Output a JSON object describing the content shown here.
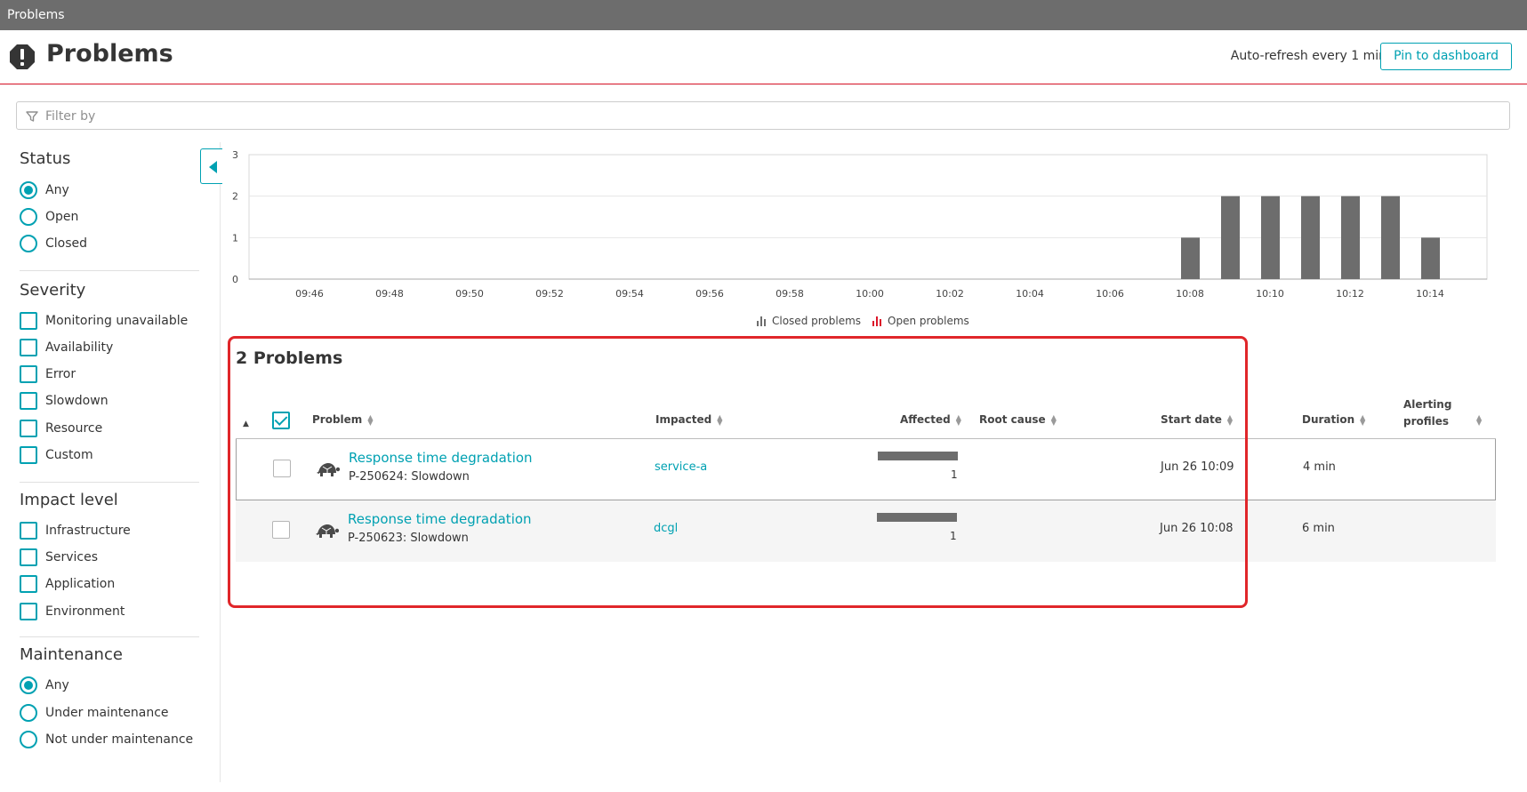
{
  "window": {
    "title": "Problems"
  },
  "header": {
    "title": "Problems",
    "auto_refresh": "Auto-refresh every 1 min",
    "pin_label": "Pin to dashboard"
  },
  "filter": {
    "placeholder": "Filter by"
  },
  "sidebar": {
    "status": {
      "title": "Status",
      "options": [
        "Any",
        "Open",
        "Closed"
      ],
      "selected": "Any"
    },
    "severity": {
      "title": "Severity",
      "options": [
        "Monitoring unavailable",
        "Availability",
        "Error",
        "Slowdown",
        "Resource",
        "Custom"
      ]
    },
    "impact": {
      "title": "Impact level",
      "options": [
        "Infrastructure",
        "Services",
        "Application",
        "Environment"
      ]
    },
    "maintenance": {
      "title": "Maintenance",
      "options": [
        "Any",
        "Under maintenance",
        "Not under maintenance"
      ],
      "selected": "Any"
    }
  },
  "chart_data": {
    "type": "bar",
    "categories": [
      "09:46",
      "09:47",
      "09:48",
      "09:49",
      "09:50",
      "09:51",
      "09:52",
      "09:53",
      "09:54",
      "09:55",
      "09:56",
      "09:57",
      "09:58",
      "09:59",
      "10:00",
      "10:01",
      "10:02",
      "10:03",
      "10:04",
      "10:05",
      "10:06",
      "10:07",
      "10:08",
      "10:09",
      "10:10",
      "10:11",
      "10:12",
      "10:13",
      "10:14"
    ],
    "x_tick_labels": [
      "09:46",
      "09:48",
      "09:50",
      "09:52",
      "09:54",
      "09:56",
      "09:58",
      "10:00",
      "10:02",
      "10:04",
      "10:06",
      "10:08",
      "10:10",
      "10:12",
      "10:14"
    ],
    "series": [
      {
        "name": "Closed problems",
        "color": "#6d6d6d",
        "values": [
          0,
          0,
          0,
          0,
          0,
          0,
          0,
          0,
          0,
          0,
          0,
          0,
          0,
          0,
          0,
          0,
          0,
          0,
          0,
          0,
          0,
          0,
          1,
          2,
          2,
          2,
          2,
          2,
          1
        ]
      },
      {
        "name": "Open problems",
        "color": "#dc172a",
        "values": [
          0,
          0,
          0,
          0,
          0,
          0,
          0,
          0,
          0,
          0,
          0,
          0,
          0,
          0,
          0,
          0,
          0,
          0,
          0,
          0,
          0,
          0,
          0,
          0,
          0,
          0,
          0,
          0,
          0
        ]
      }
    ],
    "y_ticks": [
      "0",
      "1",
      "2",
      "3"
    ],
    "ylim": [
      0,
      3
    ],
    "grid": true,
    "legend": "bottom-center"
  },
  "problems": {
    "count_label": "2 Problems",
    "columns": {
      "problem": "Problem",
      "impacted": "Impacted",
      "affected": "Affected",
      "root_cause": "Root cause",
      "start_date": "Start date",
      "duration": "Duration",
      "alerting_1": "Alerting",
      "alerting_2": "profiles"
    },
    "rows": [
      {
        "name": "Response time degradation",
        "id": "P-250624: Slowdown",
        "impacted": "service-a",
        "affected": "1",
        "affected_fraction": 1,
        "start": "Jun 26 10:09",
        "duration": "4 min"
      },
      {
        "name": "Response time degradation",
        "id": "P-250623: Slowdown",
        "impacted": "dcgl",
        "affected": "1",
        "affected_fraction": 1,
        "start": "Jun 26 10:08",
        "duration": "6 min"
      }
    ]
  }
}
